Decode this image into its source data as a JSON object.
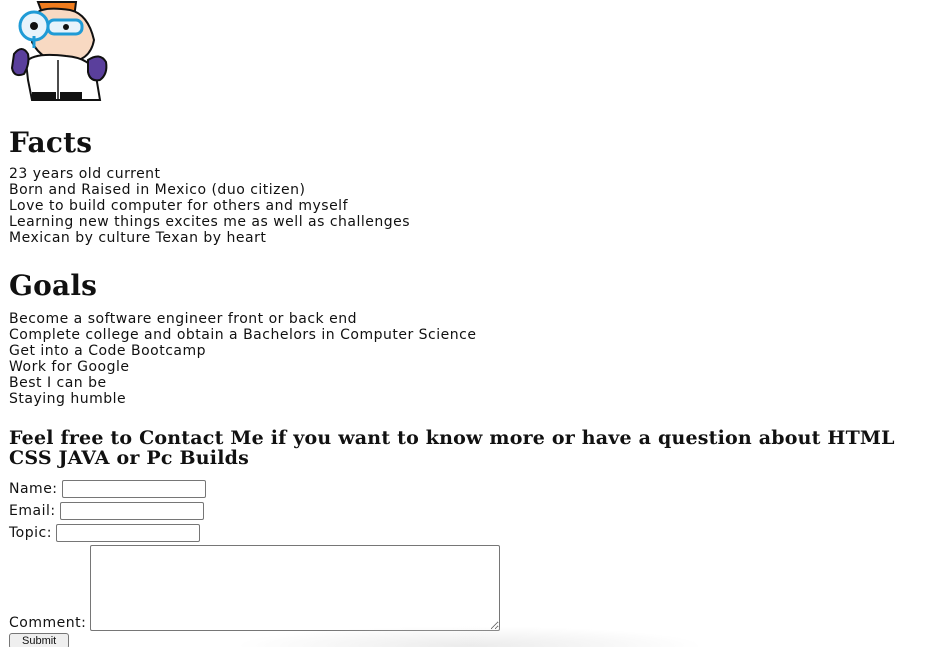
{
  "logo": {
    "icon": "dexter-cartoon-avatar",
    "colors": {
      "hair": "#f07c1e",
      "glasses": "#1f9bd6",
      "gloves": "#5a3f9c",
      "outline": "#111111",
      "coat": "#ffffff",
      "skin": "#f8d9c2"
    }
  },
  "facts": {
    "title": "Facts",
    "items": [
      "23 years old current",
      "Born and Raised in Mexico (duo citizen)",
      "Love to build computer for others and myself",
      "Learning new things excites me as well as challenges",
      "Mexican by culture Texan by heart"
    ]
  },
  "goals": {
    "title": "Goals",
    "items": [
      "Become a software engineer front or back end",
      "Complete college and obtain a Bachelors in Computer Science",
      "Get into a Code Bootcamp",
      "Work for Google",
      "Best I can be",
      "Staying humble"
    ]
  },
  "contact": {
    "heading": "Feel free to Contact Me if you want to know more or have a question about HTML CSS JAVA or Pc Builds",
    "fields": {
      "name_label": "Name:",
      "name_value": "",
      "email_label": "Email:",
      "email_value": "",
      "topic_label": "Topic:",
      "topic_value": "",
      "comment_label": "Comment:",
      "comment_value": ""
    },
    "submit_label": "Submit"
  }
}
